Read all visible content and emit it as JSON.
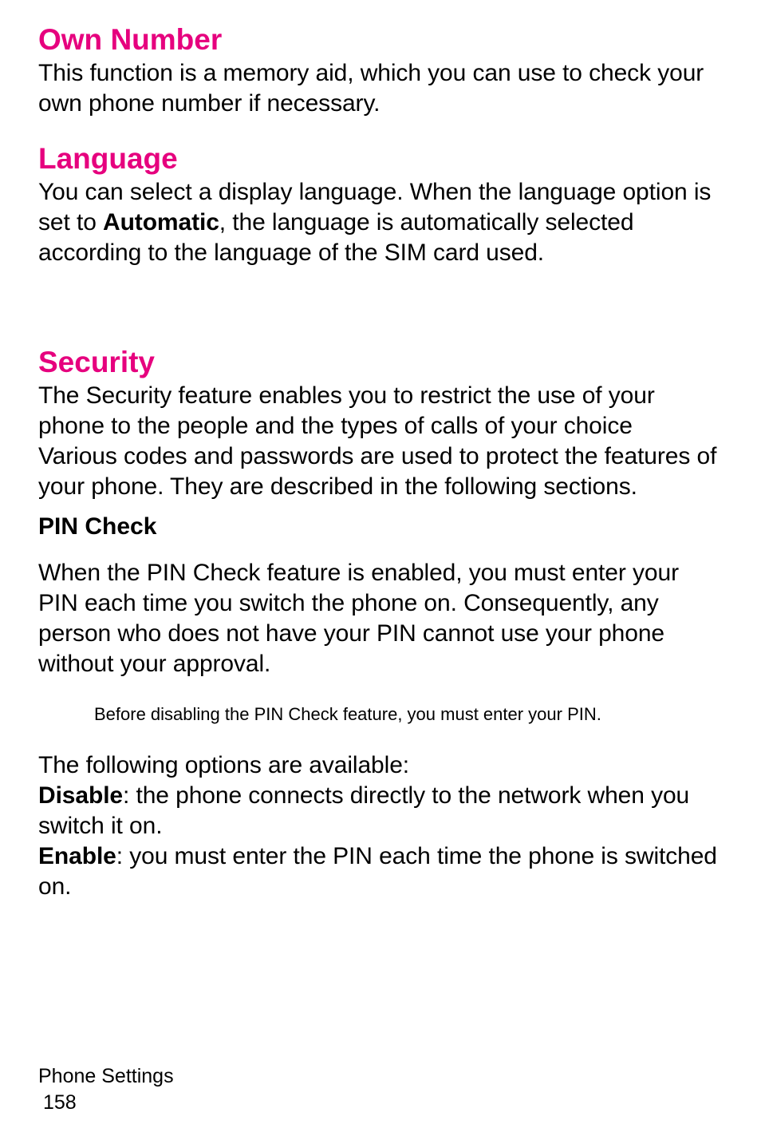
{
  "sections": {
    "own_number": {
      "heading": "Own Number",
      "body": "This function is a memory aid, which you can use to check your own phone number if necessary."
    },
    "language": {
      "heading": "Language",
      "body_pre": "You can select a display language. When the language option is set to ",
      "body_bold": "Automatic",
      "body_post": ", the language is automatically selected according to the language of the SIM card used."
    },
    "security": {
      "heading": "Security",
      "p1": "The Security feature enables you to restrict the use of your phone to the people and the types of calls of your choice",
      "p2": "Various codes and passwords are used to protect the features of your phone. They are described in the following sections."
    },
    "pin_check": {
      "heading": "PIN Check",
      "p1": "When the PIN Check feature is enabled, you must enter your PIN each time you switch the phone on. Consequently, any person who does not have your PIN cannot use your phone without your approval.",
      "note": "Before disabling the PIN Check feature, you must enter your PIN.",
      "p2": "The following options are available:",
      "opt1_bold": "Disable",
      "opt1_rest": ": the phone connects directly to the network when you switch it on.",
      "opt2_bold": "Enable",
      "opt2_rest": ": you must enter the PIN each time the phone is switched on."
    }
  },
  "footer": {
    "section_label": "Phone Settings",
    "page_number": "158"
  }
}
